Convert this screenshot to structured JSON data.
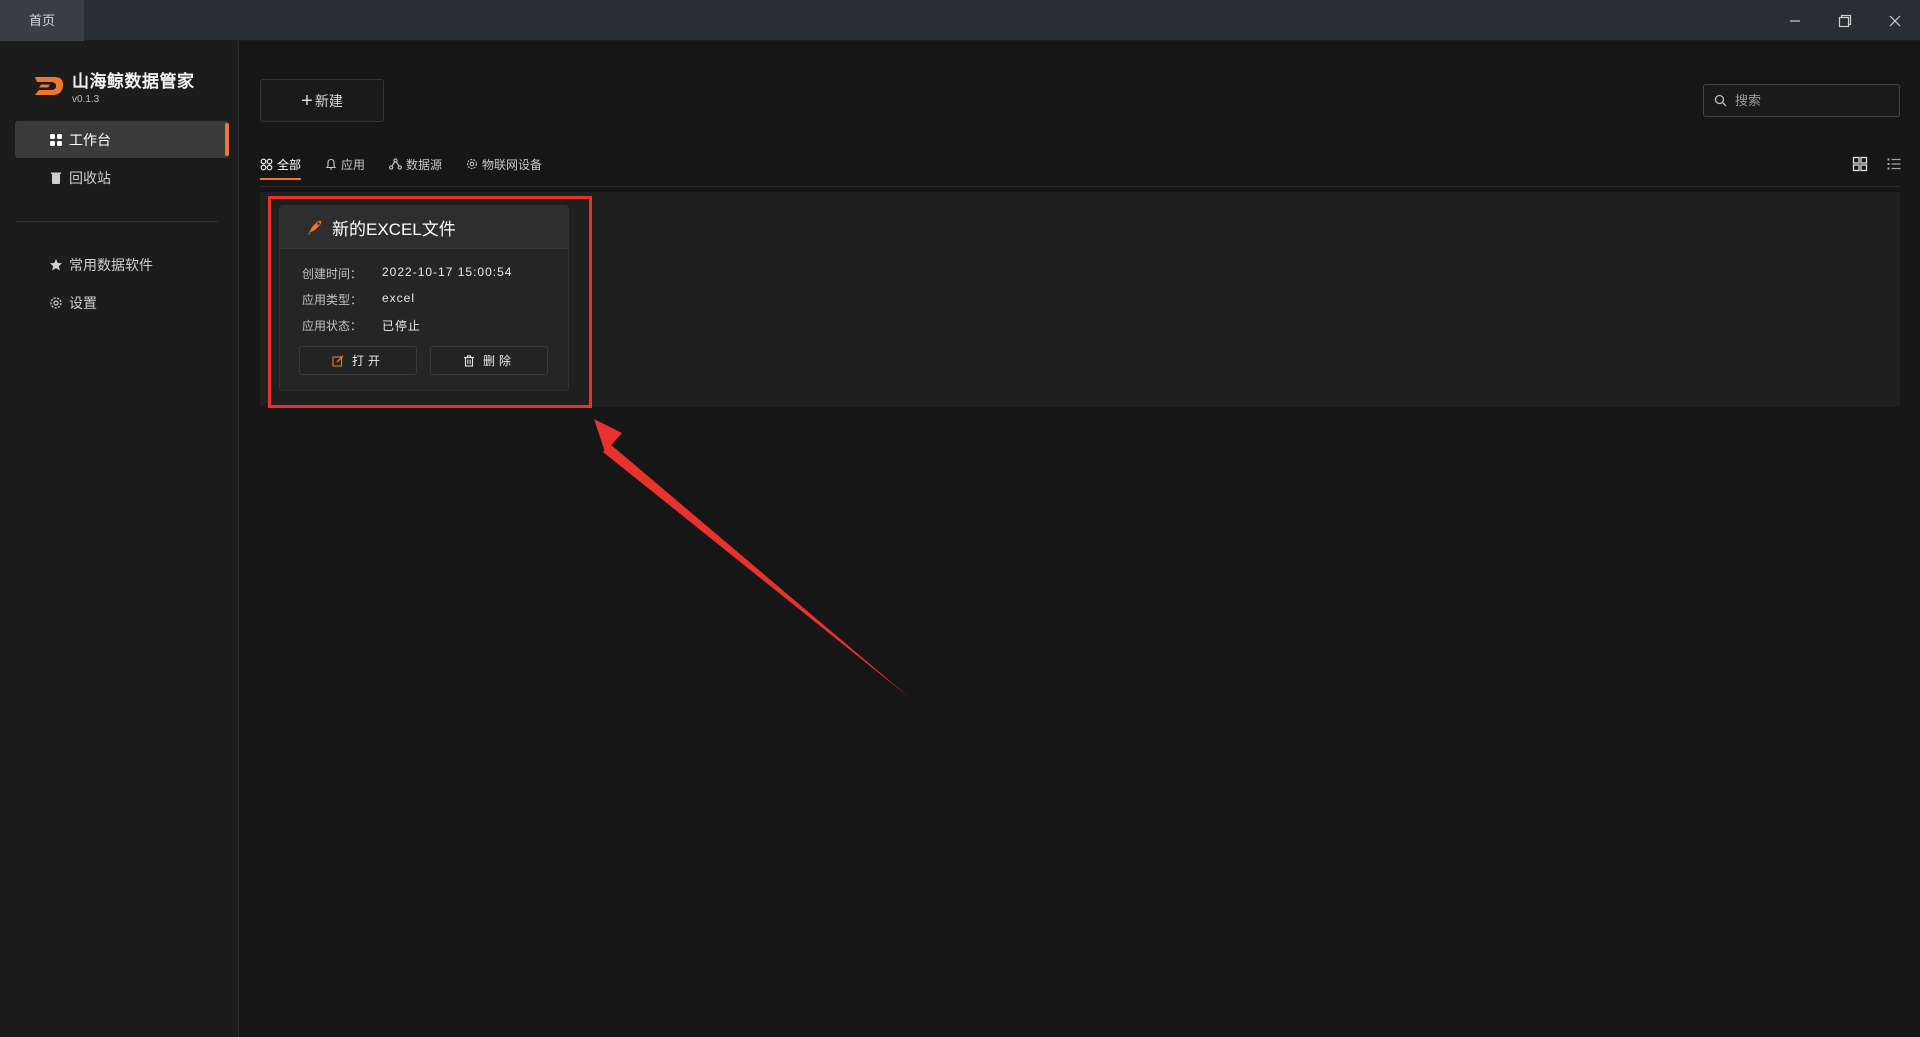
{
  "titlebar": {
    "tab_label": "首页"
  },
  "brand": {
    "name": "山海鲸数据管家",
    "version": "v0.1.3",
    "accent": "#f0782a"
  },
  "sidebar": {
    "items": [
      {
        "label": "工作台",
        "icon": "grid-icon",
        "active": true
      },
      {
        "label": "回收站",
        "icon": "trash-icon",
        "active": false
      },
      {
        "label": "常用数据软件",
        "icon": "star-icon",
        "active": false
      },
      {
        "label": "设置",
        "icon": "gear-icon",
        "active": false
      }
    ]
  },
  "toolbar": {
    "new_label": "新建",
    "search_placeholder": "搜索"
  },
  "filters": [
    {
      "label": "全部",
      "icon": "all-icon",
      "active": true
    },
    {
      "label": "应用",
      "icon": "bell-icon",
      "active": false
    },
    {
      "label": "数据源",
      "icon": "network-icon",
      "active": false
    },
    {
      "label": "物联网设备",
      "icon": "device-icon",
      "active": false
    }
  ],
  "card": {
    "title": "新的EXCEL文件",
    "fields": [
      {
        "key": "创建时间：",
        "value": "2022-10-17 15:00:54"
      },
      {
        "key": "应用类型：",
        "value": "excel"
      },
      {
        "key": "应用状态：",
        "value": "已停止"
      }
    ],
    "open_label": "打开",
    "delete_label": "删除"
  },
  "annotation": {
    "color": "#e8322c"
  }
}
